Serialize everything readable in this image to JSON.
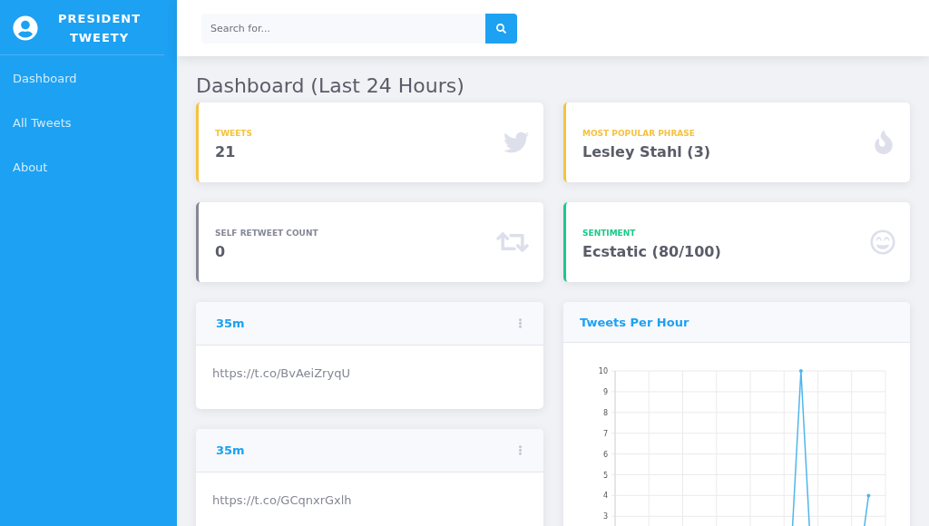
{
  "sidebar": {
    "brand": [
      "PRESIDENT",
      "TWEETY"
    ],
    "items": [
      {
        "label": "Dashboard"
      },
      {
        "label": "All Tweets"
      },
      {
        "label": "About"
      }
    ]
  },
  "search": {
    "placeholder": "Search for..."
  },
  "page_title": "Dashboard (Last 24 Hours)",
  "stats": [
    {
      "label": "TWEETS",
      "value": "21",
      "color": "#f6c23e",
      "kind": "twitter"
    },
    {
      "label": "MOST POPULAR PHRASE",
      "value": "Lesley Stahl (3)",
      "color": "#f6c23e",
      "kind": "fire"
    },
    {
      "label": "SELF RETWEET COUNT",
      "value": "0",
      "color": "#858796",
      "kind": "retweet"
    },
    {
      "label": "SENTIMENT",
      "value": "Ecstatic (80/100)",
      "color": "#1cc88a",
      "kind": "smile"
    }
  ],
  "tweets": [
    {
      "time": "35m",
      "text": "https://t.co/BvAeiZryqU"
    },
    {
      "time": "35m",
      "text": "https://t.co/GCqnxrGxlh"
    }
  ],
  "chart": {
    "title": "Tweets Per Hour",
    "chart_data": {
      "type": "line",
      "categories": [
        null,
        null,
        null,
        null,
        null,
        null,
        null,
        null,
        null,
        null,
        null,
        null,
        null,
        null,
        null,
        null,
        null,
        null,
        null,
        null,
        null,
        null,
        null,
        null
      ],
      "series": [
        {
          "color": "#4eb6ec",
          "values": [
            null,
            null,
            null,
            null,
            null,
            null,
            null,
            null,
            null,
            null,
            null,
            null,
            null,
            null,
            null,
            0,
            10,
            0,
            null,
            null,
            null,
            0,
            4,
            null
          ]
        }
      ],
      "grid": true,
      "ylim": [
        0,
        10
      ],
      "yticks": [
        3,
        4,
        5,
        6,
        7,
        8,
        9,
        10
      ]
    }
  }
}
